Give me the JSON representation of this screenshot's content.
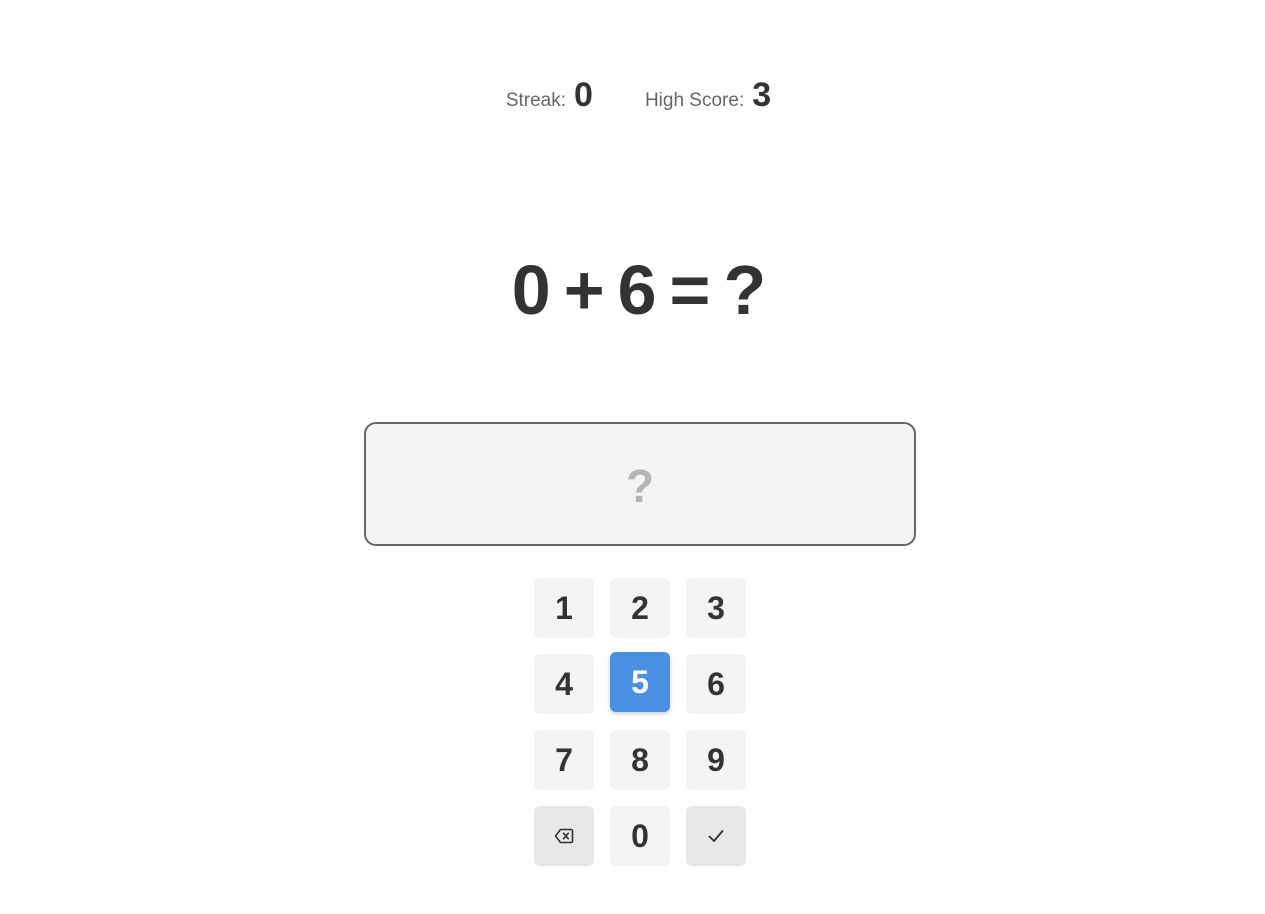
{
  "stats": {
    "streak_label": "Streak:",
    "streak_value": "0",
    "high_score_label": "High Score:",
    "high_score_value": "3"
  },
  "equation": {
    "left": "0",
    "operator": "+",
    "right": "6",
    "equals": "=",
    "unknown": "?"
  },
  "answer": {
    "value": "",
    "placeholder": "?"
  },
  "keypad": {
    "keys": [
      "1",
      "2",
      "3",
      "4",
      "5",
      "6",
      "7",
      "8",
      "9",
      "0"
    ],
    "highlighted_key": "5",
    "backspace_icon": "backspace-icon",
    "submit_icon": "checkmark-icon"
  },
  "colors": {
    "accent": "#4a90e2",
    "key_bg": "#f4f4f4",
    "action_key_bg": "#e8e8e8",
    "text": "#333333"
  }
}
